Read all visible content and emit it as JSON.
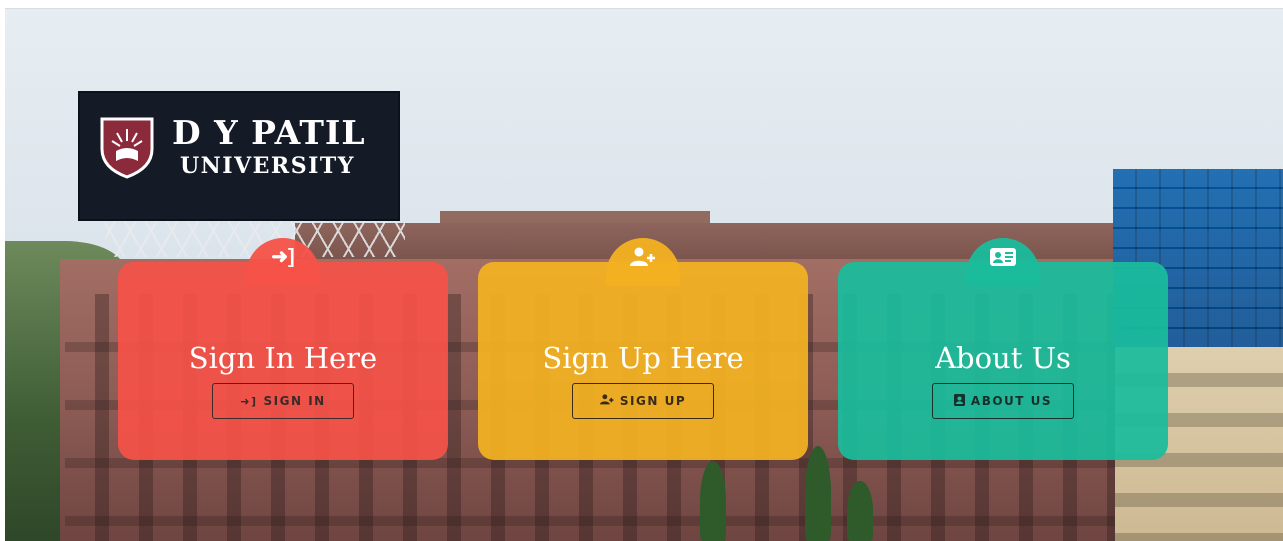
{
  "billboard": {
    "line1": "D Y PATIL",
    "line2": "UNIVERSITY",
    "logo_icon": "university-crest-icon"
  },
  "cards": [
    {
      "id": "signin",
      "tab_icon": "sign-in-icon",
      "title": "Sign In Here",
      "button_icon": "sign-in-icon",
      "button_label": "SIGN IN",
      "color": "#F55248"
    },
    {
      "id": "signup",
      "tab_icon": "user-plus-icon",
      "title": "Sign Up Here",
      "button_icon": "user-plus-icon",
      "button_label": "SIGN UP",
      "color": "#F3B121"
    },
    {
      "id": "about",
      "tab_icon": "address-card-icon",
      "title": "About Us",
      "button_icon": "address-book-icon",
      "button_label": "ABOUT US",
      "color": "#1ABC9C"
    }
  ]
}
